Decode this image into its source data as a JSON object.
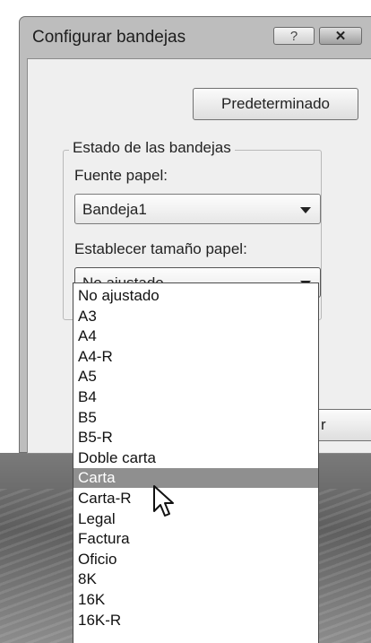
{
  "window": {
    "title": "Configurar bandejas",
    "help_label": "?",
    "close_label": "✕"
  },
  "main": {
    "default_button": "Predeterminado",
    "group_title": "Estado de las bandejas",
    "paper_source_label": "Fuente papel:",
    "paper_source_value": "Bandeja1",
    "paper_size_label": "Establecer tamaño papel:",
    "paper_size_value": "No ajustado",
    "hidden_button_partial": "r"
  },
  "dropdown": {
    "options": [
      "No ajustado",
      "A3",
      "A4",
      "A4-R",
      "A5",
      "B4",
      "B5",
      "B5-R",
      "Doble carta",
      "Carta",
      "Carta-R",
      "Legal",
      "Factura",
      "Oficio",
      "8K",
      "16K",
      "16K-R"
    ],
    "highlighted": "Carta"
  },
  "icons": {
    "dropdown_arrow": "chevron-down-icon",
    "cursor": "mouse-pointer-icon"
  },
  "colors": {
    "highlight": "#8f8f8f",
    "dialog_bg": "#efefef",
    "frame": "#bdbdbd"
  }
}
